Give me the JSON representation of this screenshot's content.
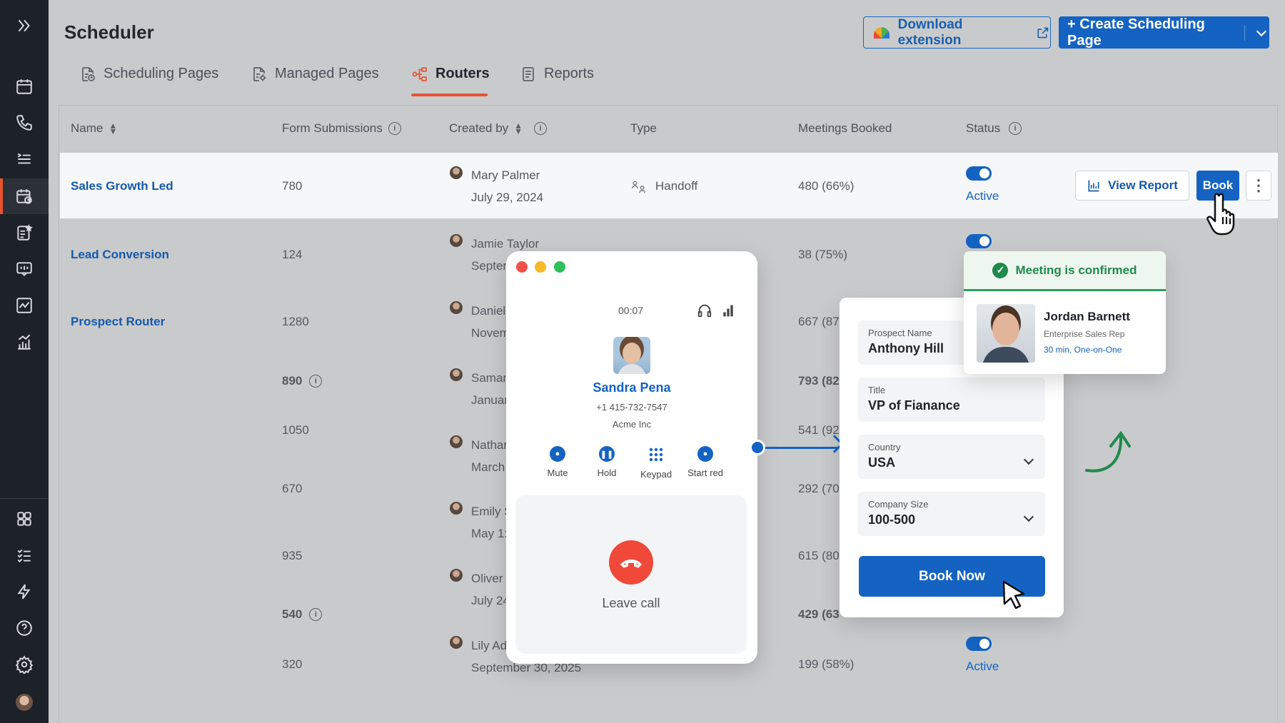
{
  "header": {
    "title": "Scheduler",
    "download_label": "Download extension",
    "create_label": "+ Create Scheduling Page"
  },
  "tabs": [
    {
      "label": "Scheduling Pages",
      "icon": "document-clock-icon"
    },
    {
      "label": "Managed Pages",
      "icon": "document-settings-icon"
    },
    {
      "label": "Routers",
      "icon": "router-icon",
      "active": true
    },
    {
      "label": "Reports",
      "icon": "report-icon"
    }
  ],
  "columns": {
    "name": "Name",
    "form_submissions": "Form Submissions",
    "created_by": "Created by",
    "type": "Type",
    "meetings_booked": "Meetings Booked",
    "status": "Status"
  },
  "rows": [
    {
      "name": "Sales Growth Led",
      "submissions": "780",
      "creator": "Mary Palmer",
      "date": "July 29, 2024",
      "type": "Handoff",
      "meetings": "480 (66%)",
      "status": "Active"
    },
    {
      "name": "Lead Conversion",
      "submissions": "124",
      "creator": "Jamie Taylor",
      "date": "Septer",
      "meetings": "38 (75%)"
    },
    {
      "name": "Prospect Router",
      "submissions": "1280",
      "creator": "Daniel",
      "date": "Novem",
      "meetings": "667 (87"
    },
    {
      "submissions": "890",
      "creator": "Saman",
      "date": "Januar",
      "meetings": "793 (82"
    },
    {
      "submissions": "1050",
      "creator": "Nathar",
      "date": "March",
      "meetings": "541 (92"
    },
    {
      "submissions": "670",
      "creator": "Emily S",
      "date": "May 1:",
      "meetings": "292 (70"
    },
    {
      "submissions": "935",
      "creator": "Oliver",
      "date": "July 24",
      "meetings": "615 (80"
    },
    {
      "submissions": "540",
      "creator": "",
      "date": "",
      "meetings": "429 (63"
    },
    {
      "submissions": "320",
      "creator": "Lily Ad",
      "date": "September 30, 2025",
      "meetings": "199 (58%)",
      "status": "Active"
    }
  ],
  "row_actions": {
    "view_report": "View Report",
    "book": "Book"
  },
  "call": {
    "timer": "00:07",
    "caller_name": "Sandra Pena",
    "phone": "+1 415-732-7547",
    "company": "Acme Inc",
    "controls": [
      "Mute",
      "Hold",
      "Keypad",
      "Start red"
    ],
    "leave_label": "Leave call"
  },
  "form": {
    "fields": [
      {
        "label": "Prospect Name",
        "value": "Anthony Hill"
      },
      {
        "label": "Title",
        "value": "VP of Fianance"
      },
      {
        "label": "Country",
        "value": "USA"
      },
      {
        "label": "Company Size",
        "value": "100-500"
      }
    ],
    "submit_label": "Book Now"
  },
  "confirmation": {
    "message": "Meeting is confirmed",
    "rep_name": "Jordan Barnett",
    "rep_title": "Enterprise Sales Rep",
    "meeting_meta": "30 min, One-on-One"
  },
  "colors": {
    "accent": "#1463c2",
    "active_tab": "#e8532f",
    "success": "#1f8a4c",
    "danger": "#f0493a",
    "sidebar": "#1d2128"
  }
}
